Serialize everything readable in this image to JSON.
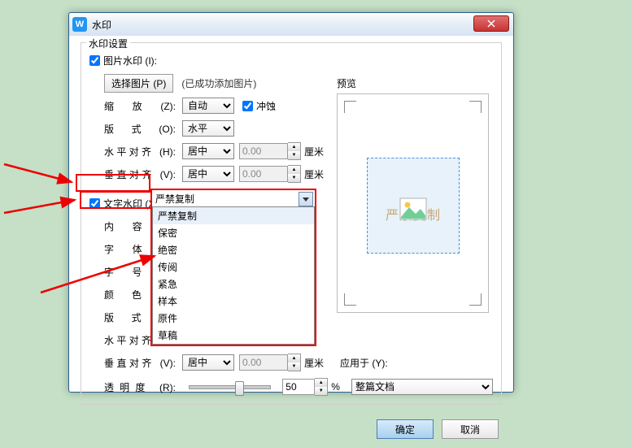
{
  "window": {
    "title": "水印"
  },
  "fieldset_title": "水印设置",
  "image_wm": {
    "checkbox_label": "图片水印 (I):",
    "select_pic_btn": "选择图片 (P)",
    "added_hint": "(已成功添加图片)",
    "scale_label": "缩    放 (Z):",
    "scale_value": "自动",
    "washout_label": "冲蚀",
    "layout_label": "版    式 (O):",
    "layout_value": "水平",
    "halign_label": "水平对齐 (H):",
    "halign_value": "居中",
    "halign_num": "0.00",
    "valign_label": "垂直对齐 (V):",
    "valign_value": "居中",
    "valign_num": "0.00",
    "unit": "厘米"
  },
  "text_wm": {
    "checkbox_label": "文字水印 (X)",
    "content_label": "内    容 (T):",
    "content_value": "严禁复制",
    "options": [
      "严禁复制",
      "保密",
      "绝密",
      "传阅",
      "紧急",
      "样本",
      "原件",
      "草稿"
    ],
    "font_label": "字    体 (F):",
    "size_label": "字    号 (S):",
    "color_label": "颜    色 (C):",
    "layout_label": "版    式 (O):",
    "halign_label": "水平对齐 (H):",
    "valign_label": "垂直对齐 (V):",
    "valign_value": "居中",
    "valign_num": "0.00",
    "unit": "厘米"
  },
  "transparency": {
    "label": "透明度 (R):",
    "value": "50",
    "suffix": "%"
  },
  "apply": {
    "label": "应用于 (Y):",
    "value": "整篇文档"
  },
  "preview": {
    "title": "预览",
    "wm_text": "严禁复制"
  },
  "buttons": {
    "ok": "确定",
    "cancel": "取消"
  }
}
